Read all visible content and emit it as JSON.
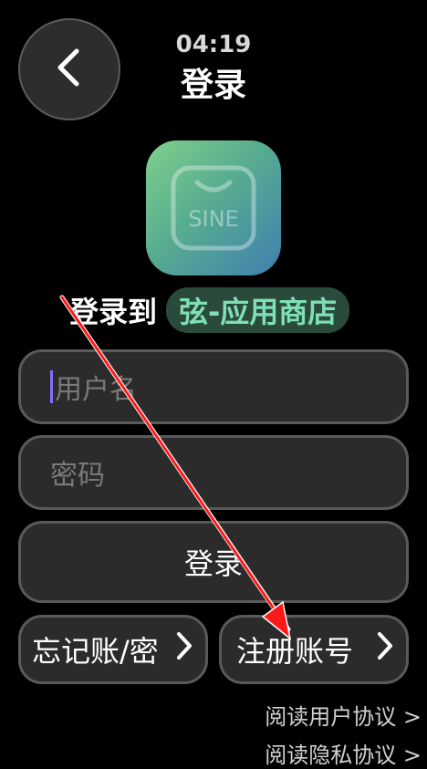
{
  "header": {
    "time": "04:19",
    "title": "登录"
  },
  "app": {
    "icon_text": "SINE",
    "login_to_label": "登录到",
    "store_name": "弦-应用商店"
  },
  "form": {
    "username_placeholder": "用户名",
    "password_placeholder": "密码",
    "login_button": "登录",
    "forgot_button": "忘记账/密",
    "register_button": "注册账号"
  },
  "links": {
    "user_agreement": "阅读用户协议 >",
    "privacy_agreement": "阅读隐私协议 >"
  },
  "colors": {
    "accent": "#7fe0b4",
    "annotation": "#ff0000"
  }
}
